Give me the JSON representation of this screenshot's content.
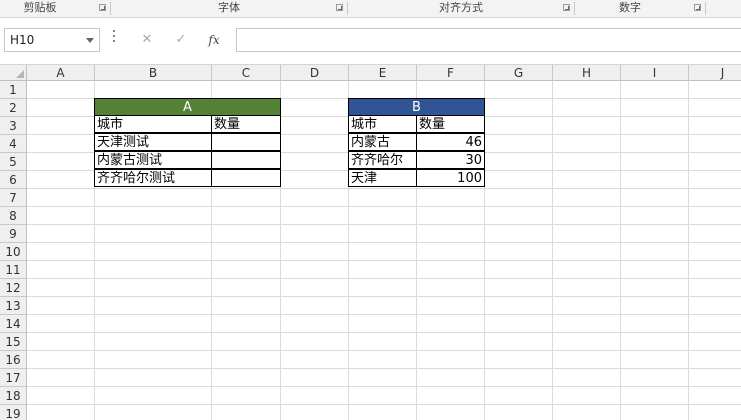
{
  "ribbon": {
    "groups": [
      {
        "label": "剪贴板"
      },
      {
        "label": "字体"
      },
      {
        "label": "对齐方式"
      },
      {
        "label": "数字"
      }
    ]
  },
  "formula_bar": {
    "name_box": "H10",
    "cancel_symbol": "✕",
    "enter_symbol": "✓",
    "fx_symbol": "fx",
    "formula": ""
  },
  "columns": [
    "A",
    "B",
    "C",
    "D",
    "E",
    "F",
    "G",
    "H",
    "I",
    "J"
  ],
  "rows": [
    "1",
    "2",
    "3",
    "4",
    "5",
    "6",
    "7",
    "8",
    "9",
    "10",
    "11",
    "12",
    "13",
    "14",
    "15",
    "16",
    "17",
    "18",
    "19"
  ],
  "table_a": {
    "title": "A",
    "title_color": "#548235",
    "headers": [
      "城市",
      "数量"
    ],
    "rows": [
      {
        "city": "天津测试",
        "qty": ""
      },
      {
        "city": "内蒙古测试",
        "qty": ""
      },
      {
        "city": "齐齐哈尔测试",
        "qty": ""
      }
    ]
  },
  "table_b": {
    "title": "B",
    "title_color": "#2f5597",
    "headers": [
      "城市",
      "数量"
    ],
    "rows": [
      {
        "city": "内蒙古",
        "qty": "46"
      },
      {
        "city": "齐齐哈尔",
        "qty": "30"
      },
      {
        "city": "天津",
        "qty": "100"
      }
    ]
  }
}
